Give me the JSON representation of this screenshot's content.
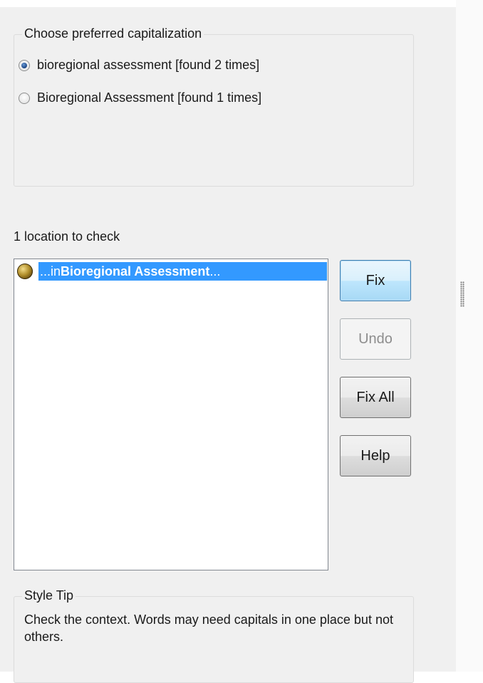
{
  "capitalization": {
    "title": "Choose preferred capitalization",
    "options": [
      {
        "label": "bioregional assessment [found 2 times]",
        "selected": true
      },
      {
        "label": "Bioregional Assessment [found 1 times]",
        "selected": false
      }
    ]
  },
  "locations": {
    "label": "1 location to check",
    "items": [
      {
        "prefix": "...in ",
        "term": "Bioregional Assessment",
        "suffix": " ...",
        "icon": "status-ball-icon"
      }
    ]
  },
  "buttons": {
    "fix": "Fix",
    "undo": "Undo",
    "fix_all": "Fix All",
    "help": "Help"
  },
  "style_tip": {
    "title": "Style Tip",
    "text": "Check the context. Words may need capitals in one place but not others."
  },
  "colors": {
    "selection": "#3399ff",
    "panel": "#f0f0f0",
    "default_button_border": "#3c7fb1"
  }
}
